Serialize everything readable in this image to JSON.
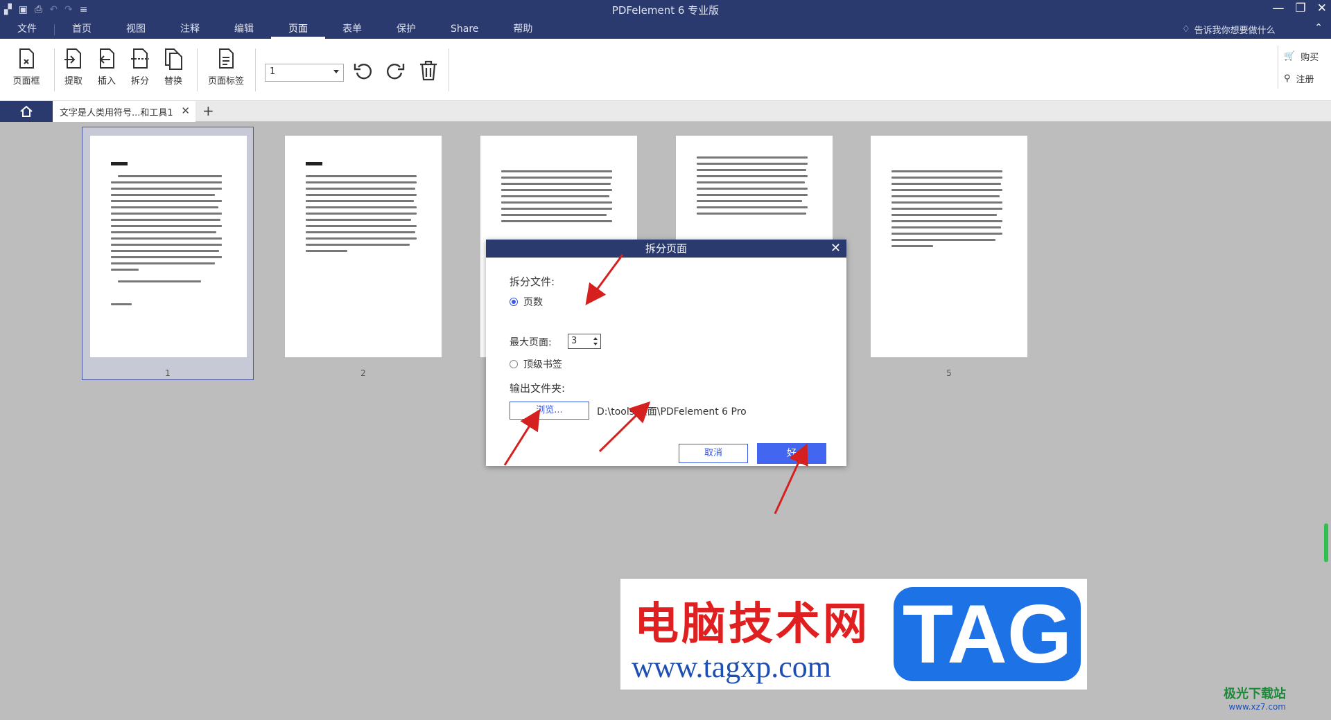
{
  "app": {
    "title": "PDFelement  6 专业版"
  },
  "menu": {
    "items": [
      "文件",
      "首页",
      "视图",
      "注释",
      "编辑",
      "页面",
      "表单",
      "保护",
      "Share",
      "帮助"
    ],
    "active_index": 5,
    "tell_me": "告诉我你想要做什么"
  },
  "ribbon": {
    "page_box": "页面框",
    "extract": "提取",
    "insert": "插入",
    "split": "拆分",
    "replace": "替换",
    "page_label": "页面标签",
    "page_select_value": "1",
    "buy": "购买",
    "register": "注册"
  },
  "tabs": {
    "doc_tab": "文字是人类用符号...和工具1"
  },
  "pages": {
    "numbers": [
      "1",
      "2",
      "",
      "",
      "5"
    ]
  },
  "dialog": {
    "title": "拆分页面",
    "split_file_label": "拆分文件:",
    "option_pages": "页数",
    "max_pages_label": "最大页面:",
    "max_pages_value": "3",
    "option_bookmarks": "顶级书签",
    "output_folder_label": "输出文件夹:",
    "browse": "浏览...",
    "output_path": "D:\\tools\\桌面\\PDFelement 6 Pro",
    "cancel": "取消",
    "ok": "好"
  },
  "watermark": {
    "brand_cn": "电脑技术网",
    "brand_url": "www.tagxp.com",
    "brand_tag": "TAG",
    "corner_cn": "极光下载站",
    "corner_url": "www.xz7.com"
  },
  "colors": {
    "titlebar": "#2b3a6e",
    "accent": "#4266f0",
    "arrow": "#d62020"
  }
}
